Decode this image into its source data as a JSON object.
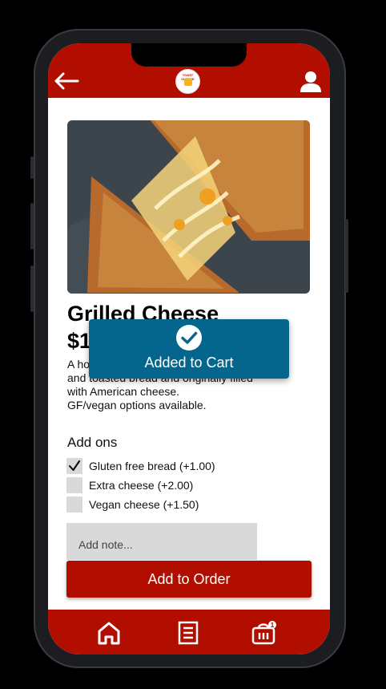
{
  "colors": {
    "brand_red": "#b10e00",
    "toast_blue": "#05668d",
    "checkbox_gray": "#d9d9d9"
  },
  "header": {
    "back_icon": "arrow-left-icon",
    "logo_text": "TOAST CHEESE",
    "profile_icon": "user-icon"
  },
  "product": {
    "title": "Grilled Cheese",
    "price": "$1",
    "description": "A ho... and toasted bread and originally filled with American cheese. GF/vegan options available.",
    "desc_line1": "A ho",
    "desc_line2": "and toasted bread and originally filled",
    "desc_line3": "with American cheese.",
    "desc_line4": "GF/vegan options available."
  },
  "addons": {
    "heading": "Add ons",
    "items": [
      {
        "label": "Gluten free bread (+1.00)",
        "checked": true
      },
      {
        "label": "Extra cheese (+2.00)",
        "checked": false
      },
      {
        "label": "Vegan cheese (+1.50)",
        "checked": false
      }
    ]
  },
  "note": {
    "placeholder": "Add note...",
    "value": ""
  },
  "order_button": {
    "label": "Add to Order"
  },
  "toast": {
    "text": "Added to Cart",
    "icon": "check-circle-icon"
  },
  "bottom_nav": {
    "items": [
      {
        "name": "home",
        "icon": "home-icon"
      },
      {
        "name": "menu",
        "icon": "list-icon"
      },
      {
        "name": "cart",
        "icon": "basket-icon",
        "badge": "1"
      }
    ]
  }
}
